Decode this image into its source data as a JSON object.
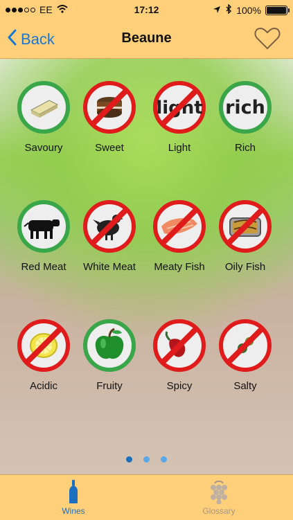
{
  "status": {
    "carrier": "EE",
    "time": "17:12",
    "battery": "100%"
  },
  "nav": {
    "back_label": "Back",
    "title": "Beaune"
  },
  "items": [
    {
      "label": "Savoury",
      "recommended": true,
      "icon": "butter-icon"
    },
    {
      "label": "Sweet",
      "recommended": false,
      "icon": "cake-icon"
    },
    {
      "label": "Light",
      "recommended": false,
      "icon": "light-text-icon",
      "icon_text": "light"
    },
    {
      "label": "Rich",
      "recommended": true,
      "icon": "rich-text-icon",
      "icon_text": "rich"
    },
    {
      "label": "Red Meat",
      "recommended": true,
      "icon": "cow-icon"
    },
    {
      "label": "White Meat",
      "recommended": false,
      "icon": "chicken-icon"
    },
    {
      "label": "Meaty Fish",
      "recommended": false,
      "icon": "salmon-icon"
    },
    {
      "label": "Oily Fish",
      "recommended": false,
      "icon": "sardine-can-icon"
    },
    {
      "label": "Acidic",
      "recommended": false,
      "icon": "lemon-icon"
    },
    {
      "label": "Fruity",
      "recommended": true,
      "icon": "apple-icon"
    },
    {
      "label": "Spicy",
      "recommended": false,
      "icon": "chili-icon"
    },
    {
      "label": "Salty",
      "recommended": false,
      "icon": "olive-skewer-icon"
    }
  ],
  "pager": {
    "pages": 3,
    "current": 1
  },
  "tabs": {
    "wines": "Wines",
    "glossary": "Glossary"
  },
  "colors": {
    "bar": "#ffcf7a",
    "good": "#3aa64a",
    "bad": "#e01b1b",
    "link": "#1976d2"
  }
}
